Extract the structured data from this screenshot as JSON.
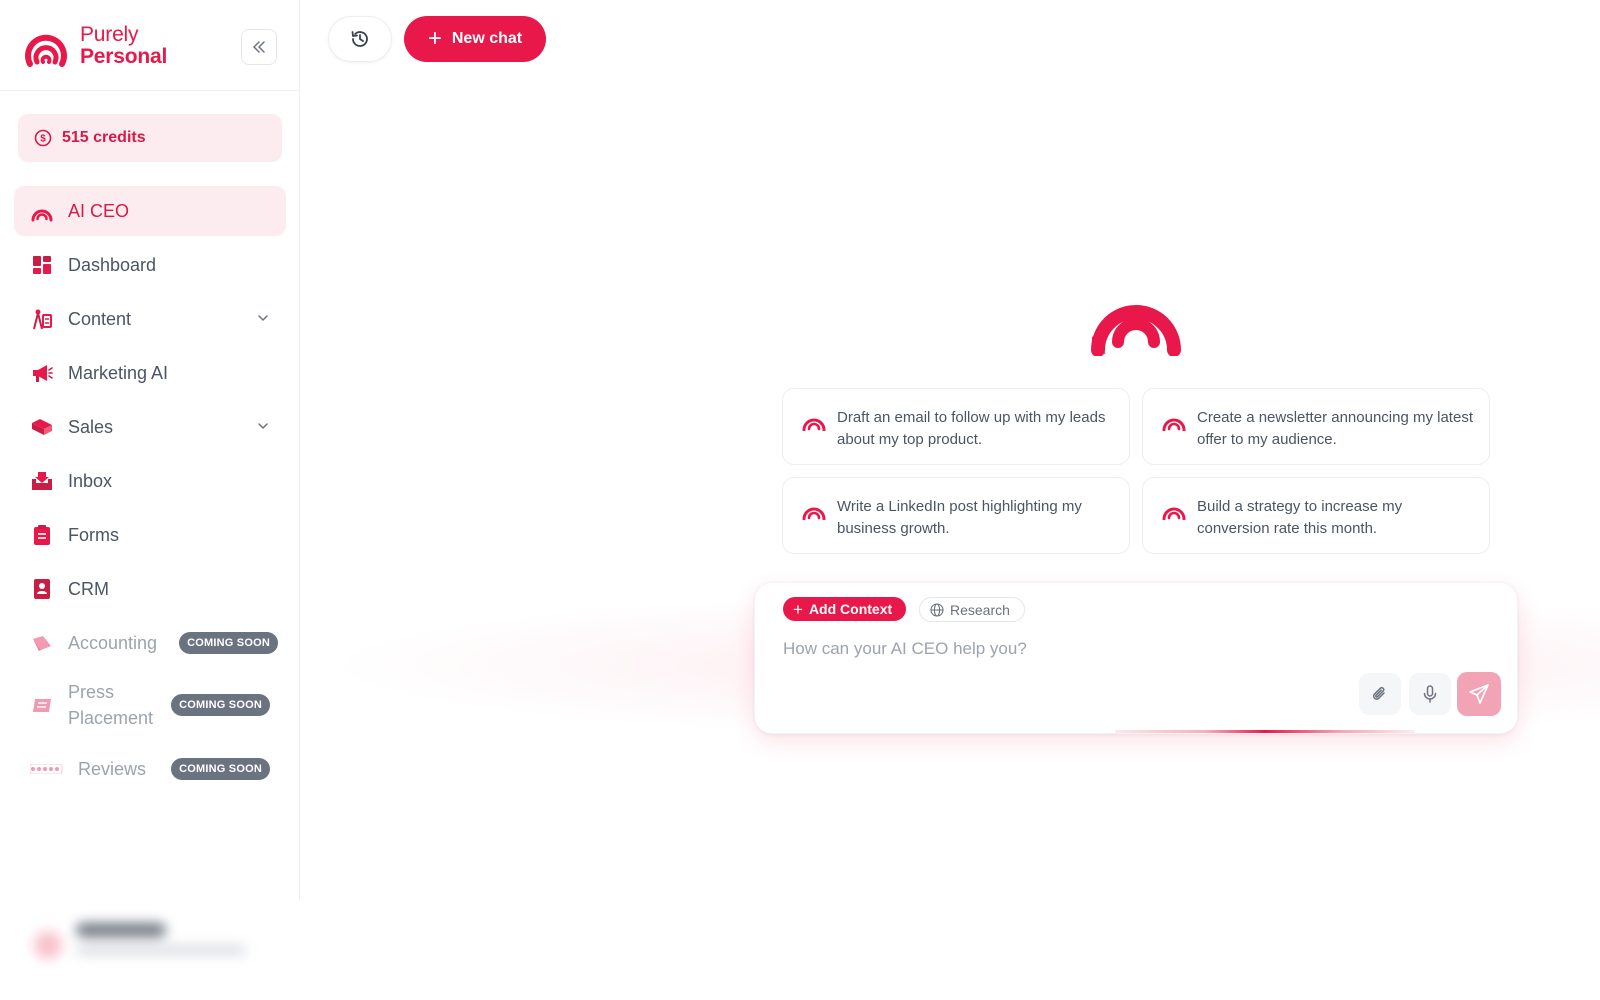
{
  "brand": {
    "line1": "Purely",
    "line2": "Personal"
  },
  "credits": {
    "label": "515 credits"
  },
  "nav": {
    "items": [
      {
        "label": "AI CEO",
        "icon": "ai-ceo-logo-icon",
        "active": true
      },
      {
        "label": "Dashboard",
        "icon": "dashboard-icon"
      },
      {
        "label": "Content",
        "icon": "content-icon",
        "expandable": true
      },
      {
        "label": "Marketing AI",
        "icon": "megaphone-icon"
      },
      {
        "label": "Sales",
        "icon": "sales-icon",
        "expandable": true
      },
      {
        "label": "Inbox",
        "icon": "inbox-icon"
      },
      {
        "label": "Forms",
        "icon": "clipboard-icon"
      },
      {
        "label": "CRM",
        "icon": "contact-book-icon"
      },
      {
        "label": "Accounting",
        "icon": "accounting-icon",
        "badge": "COMING SOON",
        "disabled": true
      },
      {
        "label": "Press Placement",
        "icon": "newspaper-icon",
        "badge": "COMING SOON",
        "disabled": true
      },
      {
        "label": "Reviews",
        "icon": "stars-icon",
        "badge": "COMING SOON",
        "disabled": true
      }
    ]
  },
  "topbar": {
    "new_chat_label": "New chat"
  },
  "suggestions": [
    {
      "text": "Draft an email to follow up with my leads about my top product."
    },
    {
      "text": "Create a newsletter announcing my latest offer to my audience."
    },
    {
      "text": "Write a LinkedIn post highlighting my business growth."
    },
    {
      "text": "Build a strategy to increase my conversion rate this month."
    }
  ],
  "composer": {
    "add_context_label": "Add Context",
    "research_label": "Research",
    "placeholder": "How can your AI CEO help you?"
  },
  "colors": {
    "accent": "#e8194a",
    "accent_soft": "#fdecef",
    "badge": "#6b7280"
  }
}
